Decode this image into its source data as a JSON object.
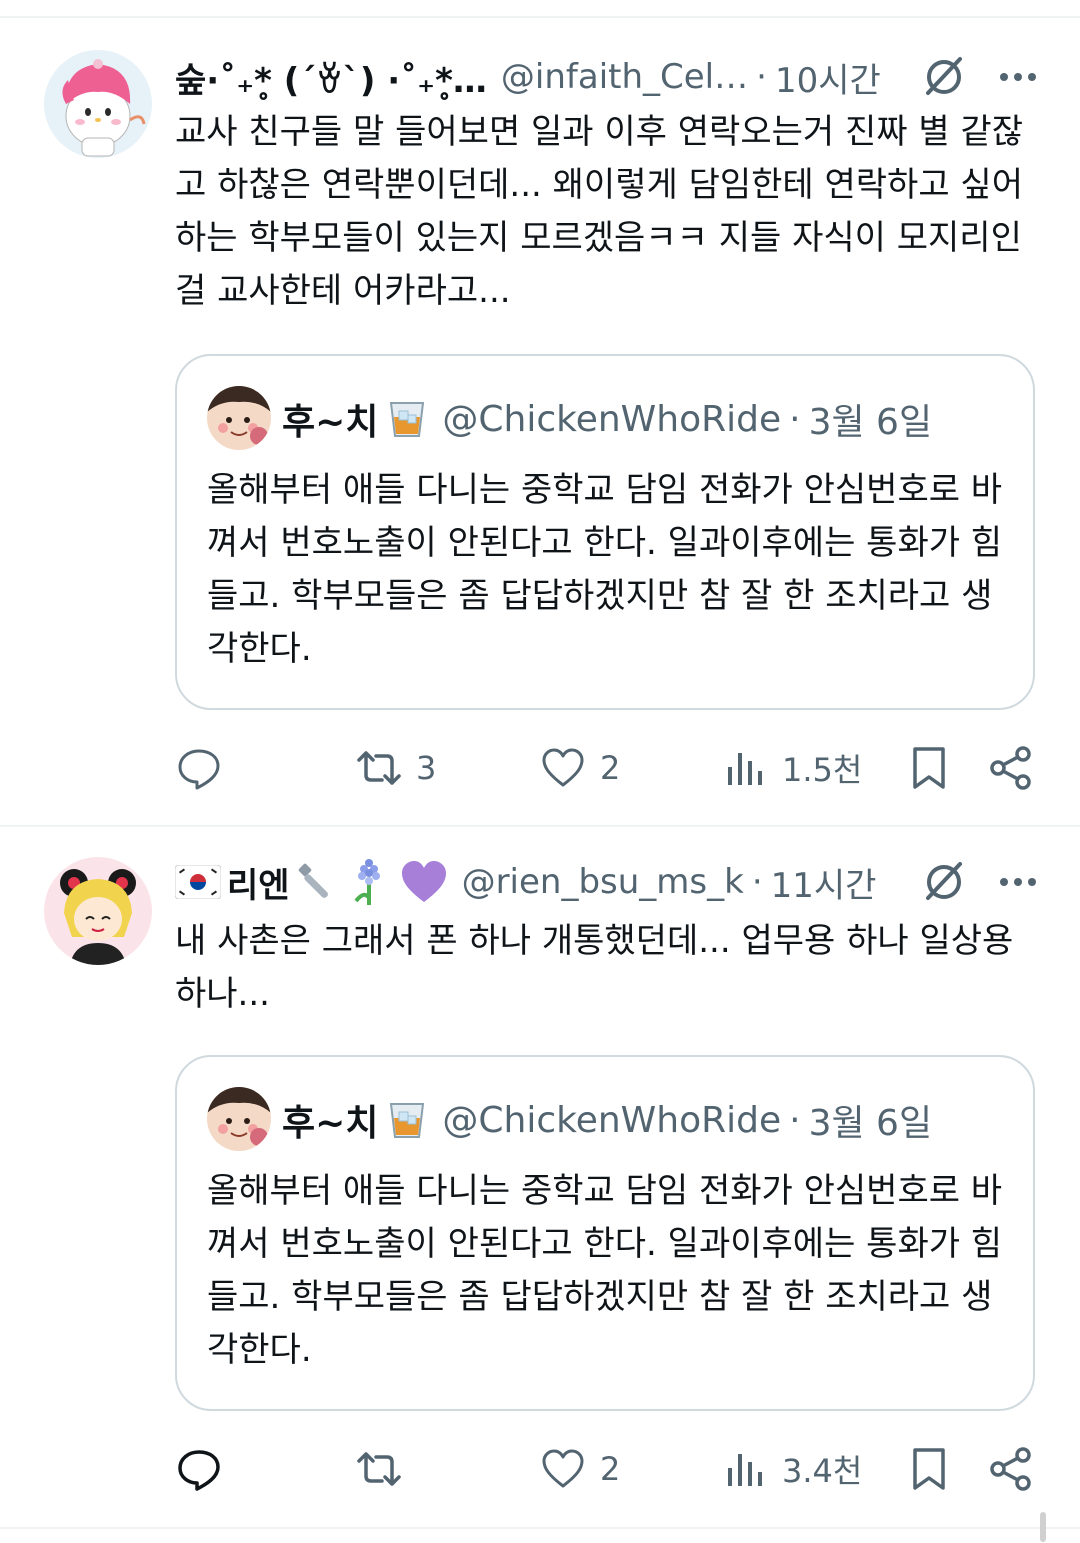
{
  "tweets": [
    {
      "display_name": "숲·˚₊*̥ (´ꈊ`) ·˚₊*̥…",
      "handle": "@infaith_Cel…",
      "time": "10시간",
      "text": "교사 친구들 말 들어보면 일과 이후 연락오는거 진짜 별 같잖고 하찮은 연락뿐이던데... 왜이렇게 담임한테 연락하고 싶어하는 학부모들이 있는지 모르겠음ㅋㅋ 지들 자식이 모지리인걸 교사한테 어카라고...",
      "avatar_icon": "my-melody-avatar",
      "quote": {
        "display_name": "후~치",
        "emoji_icon": "whiskey-glass-icon",
        "handle": "@ChickenWhoRide",
        "date": "3월 6일",
        "text": "올해부터 애들 다니는 중학교 담임 전화가 안심번호로 바껴서 번호노출이 안된다고 한다. 일과이후에는 통화가 힘들고. 학부모들은 좀 답답하겠지만 참 잘 한 조치라고 생각한다."
      },
      "actions": {
        "reply_count": "",
        "retweet_count": "3",
        "like_count": "2",
        "view_count": "1.5천"
      }
    },
    {
      "display_name": "리엔",
      "handle": "@rien_bsu_ms_k",
      "time": "11시간",
      "text": "내 사촌은 그래서 폰 하나 개통했던데... 업무용 하나 일상용 하나...",
      "avatar_icon": "anime-girl-avatar",
      "quote": {
        "display_name": "후~치",
        "emoji_icon": "whiskey-glass-icon",
        "handle": "@ChickenWhoRide",
        "date": "3월 6일",
        "text": "올해부터 애들 다니는 중학교 담임 전화가 안심번호로 바껴서 번호노출이 안된다고 한다. 일과이후에는 통화가 힘들고. 학부모들은 좀 답답하겠지만 참 잘 한 조치라고 생각한다."
      },
      "actions": {
        "reply_count": "",
        "retweet_count": "",
        "like_count": "2",
        "view_count": "3.4천"
      }
    }
  ],
  "colors": {
    "text": "#0f1419",
    "secondary": "#536471",
    "border": "#cfd9de",
    "divider": "#eff3f4",
    "heart_emoji": "#a77fd9"
  }
}
